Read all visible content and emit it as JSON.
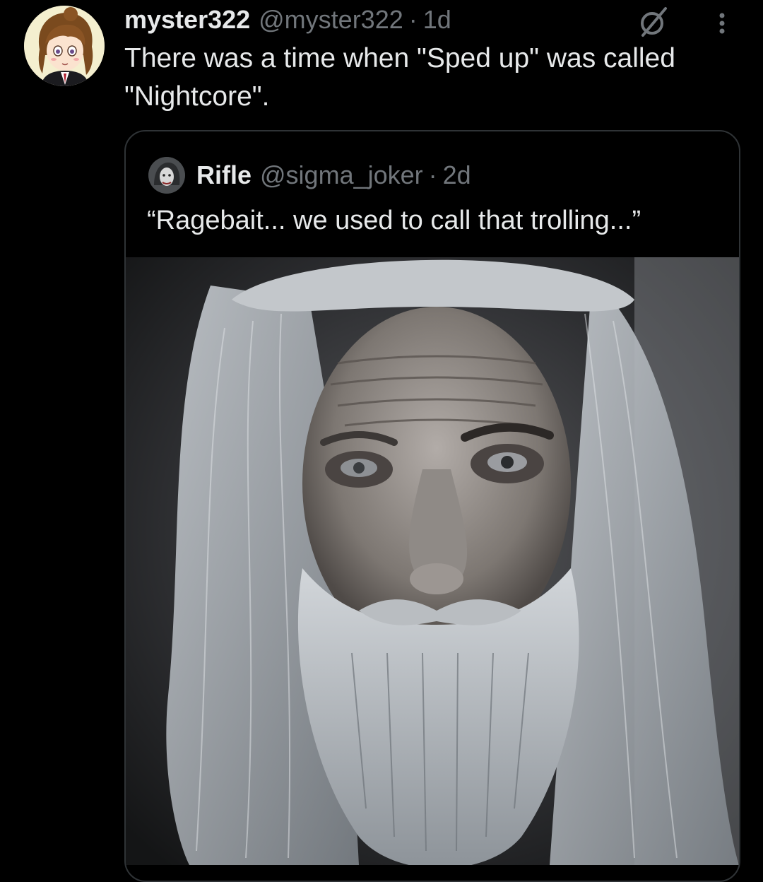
{
  "post": {
    "author_name": "myster322",
    "author_handle": "@myster322",
    "separator": "·",
    "time": "1d",
    "text": "There was a time when \"Sped up\" was called \"Nightcore\".",
    "avatar_icon": "anime-girl-avatar",
    "verified_icon": "slashed-circle-badge-icon",
    "more_icon": "vertical-ellipsis-icon"
  },
  "quoted_post": {
    "author_name": "Rifle",
    "author_handle": "@sigma_joker",
    "separator": "·",
    "time": "2d",
    "text": "“Ragebait... we used to call that trolling...”",
    "avatar_icon": "joker-avatar",
    "media": "photo-of-old-man-with-long-white-hair-and-beard"
  },
  "colors": {
    "background": "#000000",
    "text_primary": "#e7e9ea",
    "text_secondary": "#71767b",
    "card_border": "#2f3336"
  }
}
